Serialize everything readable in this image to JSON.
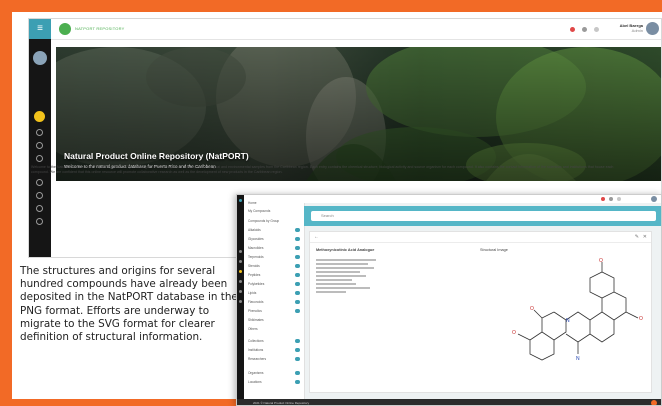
{
  "main_screen": {
    "logo_text": "NATPORT REPOSITORY",
    "menu_icon": "hamburger-icon",
    "user": {
      "name": "Abel Baerga",
      "role": "Admin"
    },
    "hero": {
      "title": "Natural Product Online Repository (NatPORT)",
      "subtitle": "Welcome to the natural product database for Puerto Rico and the Caribbean"
    },
    "description": "Welcome to the Natural Product Online Repository (NatPORT), a catalog of natural compounds isolated from biological and environmental samples from the Caribbean region. Each entry contains the chemical structure, biological activity and source organism for each compound. It also contains the contact information of the scientists and institutions that house each compound. We are confident that this online resource will promote collaborative research as well as the development of new products in the Caribbean region."
  },
  "caption": "The structures and origins for several hundred compounds have already been deposited in the NatPORT database in the PNG format. Efforts are underway to migrate to the SVG format for clearer definition of structural information.",
  "detail_screen": {
    "nav_items": [
      "Home",
      "My Compounds",
      "Compounds by Group",
      "Alkaloids",
      "Glycosides",
      "Macrolides",
      "Terpenoids",
      "Steroids",
      "Peptides",
      "Polyketides",
      "Lipids",
      "Flavonoids",
      "Phenolics",
      "Shikimates",
      "Others"
    ],
    "nav_section_2": [
      "Collections",
      "Institutions",
      "Researchers"
    ],
    "nav_section_3": [
      "Organisms",
      "Locations"
    ],
    "search_placeholder": "Search",
    "compound_name": "Methoxynicotinic Acid Analogue",
    "structure_label": "Structural Image",
    "footer": "2021 © Natural Product Online Repository"
  },
  "colors": {
    "accent_orange": "#f26a26",
    "teal": "#3c9fb3",
    "sidebar_dark": "#151515",
    "active_yellow": "#f2c21b"
  }
}
